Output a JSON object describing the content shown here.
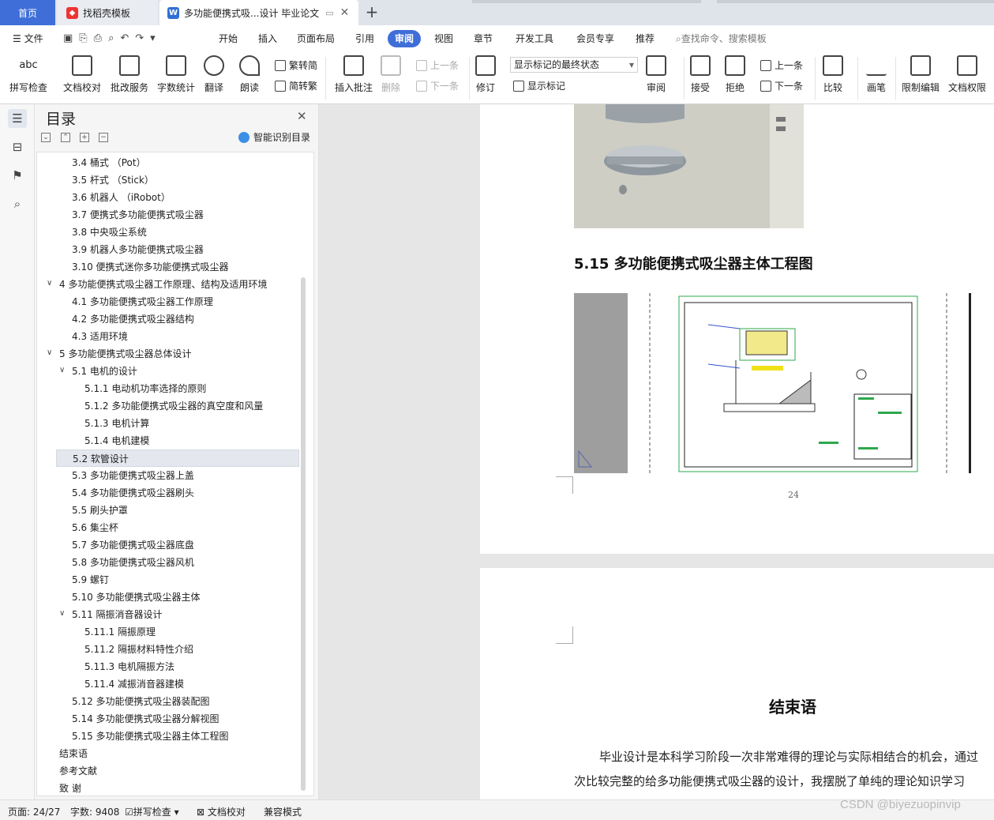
{
  "tabs": {
    "home": "首页",
    "template": "找稻壳模板",
    "doc": "多功能便携式吸...设计 毕业论文",
    "new_tab": "+"
  },
  "menu": {
    "file": "文件",
    "items": [
      "开始",
      "插入",
      "页面布局",
      "引用",
      "审阅",
      "视图",
      "章节",
      "开发工具",
      "会员专享",
      "推荐"
    ],
    "active": "审阅",
    "search_placeholder": "查找命令、搜索模板"
  },
  "ribbon": {
    "spell_check": "拼写检查",
    "doc_check": "文档校对",
    "correction_service": "批改服务",
    "word_count": "字数统计",
    "translate": "翻译",
    "read_aloud": "朗读",
    "trad_to_simp": "繁转简",
    "simp_to_trad": "简转繁",
    "insert_comment": "插入批注",
    "delete": "删除",
    "prev_comment": "上一条",
    "next_comment": "下一条",
    "track_changes": "修订",
    "markup_state": "显示标记的最终状态",
    "show_markup": "显示标记",
    "review": "审阅",
    "accept": "接受",
    "reject": "拒绝",
    "prev_change": "上一条",
    "next_change": "下一条",
    "compare": "比较",
    "ink": "画笔",
    "restrict_edit": "限制编辑",
    "doc_permission": "文档权限"
  },
  "toc": {
    "title": "目录",
    "smart": "智能识别目录",
    "items": [
      {
        "text": "3.4  桶式  （Pot）",
        "level": 2
      },
      {
        "text": "3.5  杆式  （Stick）",
        "level": 2
      },
      {
        "text": "3.6  机器人  （iRobot）",
        "level": 2
      },
      {
        "text": "3.7 便携式多功能便携式吸尘器",
        "level": 2
      },
      {
        "text": "3.8 中央吸尘系统",
        "level": 2
      },
      {
        "text": "3.9 机器人多功能便携式吸尘器",
        "level": 2
      },
      {
        "text": "3.10 便携式迷你多功能便携式吸尘器",
        "level": 2
      },
      {
        "text": "4  多功能便携式吸尘器工作原理、结构及适用环境",
        "level": 1,
        "arrow": "∨"
      },
      {
        "text": "4.1  多功能便携式吸尘器工作原理",
        "level": 2
      },
      {
        "text": "4.2  多功能便携式吸尘器结构",
        "level": 2
      },
      {
        "text": "4.3  适用环境",
        "level": 2
      },
      {
        "text": "5  多功能便携式吸尘器总体设计",
        "level": 1,
        "arrow": "∨"
      },
      {
        "text": "5.1 电机的设计",
        "level": 2,
        "arrow": "∨"
      },
      {
        "text": "5.1.1 电动机功率选择的原则",
        "level": 3
      },
      {
        "text": "5.1.2 多功能便携式吸尘器的真空度和风量",
        "level": 3
      },
      {
        "text": "5.1.3 电机计算",
        "level": 3
      },
      {
        "text": "5.1.4 电机建模",
        "level": 3
      },
      {
        "text": "5.2 软管设计",
        "level": 2,
        "selected": true
      },
      {
        "text": "5.3 多功能便携式吸尘器上盖",
        "level": 2
      },
      {
        "text": "5.4 多功能便携式吸尘器刷头",
        "level": 2
      },
      {
        "text": "5.5 刷头护罩",
        "level": 2
      },
      {
        "text": "5.6 集尘杯",
        "level": 2
      },
      {
        "text": "5.7 多功能便携式吸尘器底盘",
        "level": 2
      },
      {
        "text": "5.8 多功能便携式吸尘器风机",
        "level": 2
      },
      {
        "text": "5.9 螺钉",
        "level": 2
      },
      {
        "text": "5.10 多功能便携式吸尘器主体",
        "level": 2
      },
      {
        "text": "5.11 隔振消音器设计",
        "level": 2,
        "arrow": "∨"
      },
      {
        "text": "5.11.1 隔振原理",
        "level": 3
      },
      {
        "text": "5.11.2 隔振材料特性介绍",
        "level": 3
      },
      {
        "text": "5.11.3 电机隔振方法",
        "level": 3
      },
      {
        "text": "5.11.4 减振消音器建模",
        "level": 3
      },
      {
        "text": "5.12 多功能便携式吸尘器装配图",
        "level": 2
      },
      {
        "text": "5.14 多功能便携式吸尘器分解视图",
        "level": 2
      },
      {
        "text": "5.15 多功能便携式吸尘器主体工程图",
        "level": 2
      },
      {
        "text": "结束语",
        "level": 1
      },
      {
        "text": "参考文献",
        "level": 1
      },
      {
        "text": "致    谢",
        "level": 1
      }
    ]
  },
  "document": {
    "figure_heading": "5.15 多功能便携式吸尘器主体工程图",
    "page_number": "24",
    "chapter_title": "结束语",
    "body_lines": [
      "毕业设计是本科学习阶段一次非常难得的理论与实际相结合的机会，通过",
      "次比较完整的给多功能便携式吸尘器的设计，我摆脱了单纯的理论知识学习"
    ]
  },
  "status": {
    "page": "页面: 24/27",
    "words": "字数: 9408",
    "spell": "拼写检查",
    "doccheck": "文档校对",
    "compat": "兼容模式"
  },
  "watermark": "CSDN @biyezuopinvip"
}
